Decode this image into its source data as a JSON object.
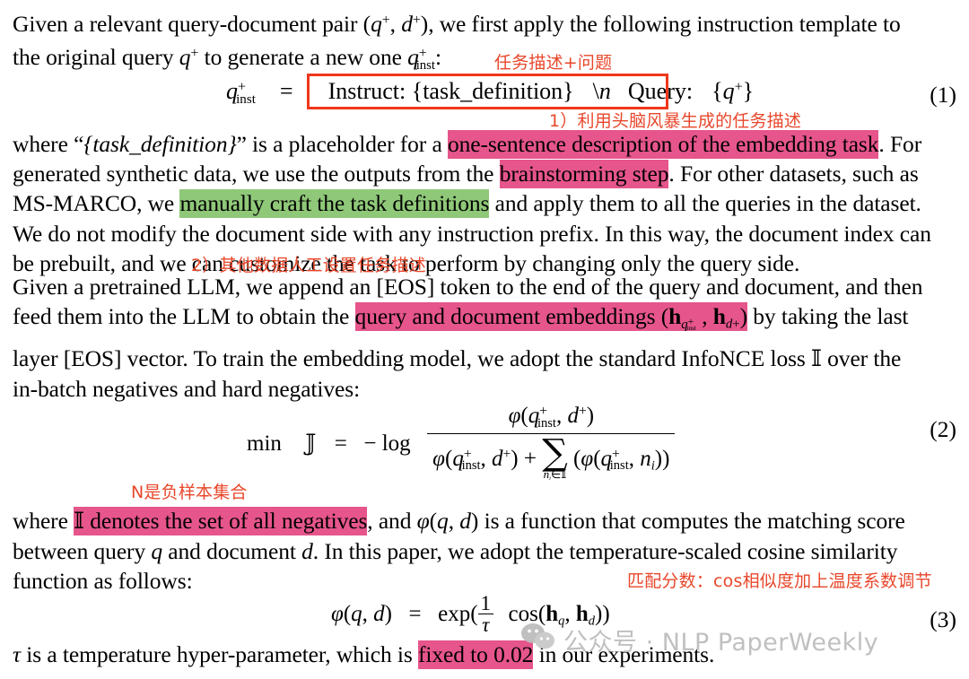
{
  "document": {
    "type": "academic-paper-excerpt-annotated",
    "paragraphs": {
      "p1": {
        "lines": [
          "Given a relevant query-document pair (q+, d+), we first apply the following instruction template to",
          "the original query q+ to generate a new one q+inst:"
        ]
      },
      "p2": {
        "line1_pre": "where “{task_definition}” is a placeholder for a ",
        "line1_hl": "one-sentence description of the embedding task",
        "line1_post": ". For",
        "line2_pre": "generated synthetic data, we use the outputs from the ",
        "line2_hl": "brainstorming step",
        "line2_post": ". For other datasets, such as",
        "line3_pre": "MS-MARCO, we ",
        "line3_hl": "manually craft the task definitions",
        "line3_post": " and apply them to all the queries in the dataset.",
        "line4": "We do not modify the document side with any instruction prefix. In this way, the document index can",
        "line5": "be prebuilt, and we can customize the task to perform by changing only the query side."
      },
      "p3": {
        "line1": "Given a pretrained LLM, we append an [EOS] token to the end of the query and document, and then",
        "line2_pre": "feed them into the LLM to obtain the ",
        "line2_hl": "query and document embeddings (h",
        "line2_hl_sub": "q+inst",
        "line2_hl_mid": " , h",
        "line2_hl_sub2": "d+",
        "line2_hl_end": ")",
        "line2_post": " by taking the last",
        "line3": "layer [EOS] vector. To train the embedding model, we adopt the standard InfoNCE loss L over the",
        "line4": "in-batch negatives and hard negatives:"
      },
      "p4": {
        "line1_pre": "where ",
        "line1_hl": "N denotes the set of all negatives",
        "line1_post": ", and ϕ(q, d) is a function that computes the matching score",
        "line2": "between query q and document d. In this paper, we adopt the temperature-scaled cosine similarity",
        "line3": "function as follows:"
      },
      "p5": {
        "pre": "τ is a temperature hyper-parameter, which is ",
        "hl": "fixed to 0.02",
        "post": " in our experiments."
      }
    },
    "equations": {
      "eq1": {
        "number": "(1)",
        "lhs": "q",
        "lhs_sup": "+",
        "lhs_sub": "inst",
        "eq_sign": "=",
        "boxed": "Instruct: {task_definition} \\n Query: {q+}",
        "boxed_parts": {
          "instruct": "Instruct: {task_definition}",
          "newline": "\\n",
          "query": "Query:",
          "qplus": "{q+}"
        }
      },
      "eq2": {
        "number": "(2)",
        "min": "min",
        "loss": "L",
        "eq_sign": "=",
        "neg_log": "− log",
        "numerator": "ϕ(q+inst, d+)",
        "denominator_left": "ϕ(q+inst, d+) +",
        "sum_sign": "∑",
        "sum_subscript": "nᵢ∈N",
        "denominator_right": "(ϕ(q+inst, nᵢ))"
      },
      "eq3": {
        "number": "(3)",
        "lhs": "ϕ(q, d)",
        "eq_sign": "=",
        "exp": "exp(",
        "frac_num": "1",
        "frac_den": "τ",
        "cos": "cos(h",
        "hq_sub": "q",
        "comma": ", h",
        "hd_sub": "d",
        "close": "))"
      }
    },
    "annotations": [
      {
        "id": "annot-1",
        "text": "任务描述+问题",
        "color": "#e8472b"
      },
      {
        "id": "annot-2",
        "text": "1）利用头脑风暴生成的任务描述",
        "color": "#e8472b"
      },
      {
        "id": "annot-3",
        "text": "2）其他数据人工设置任务描述",
        "color": "#e8472b"
      },
      {
        "id": "annot-4",
        "text": "N是负样本集合",
        "color": "#e8472b"
      },
      {
        "id": "annot-5",
        "text": "匹配分数：cos相似度加上温度系数调节",
        "color": "#e8472b"
      }
    ],
    "watermark": {
      "text": "公众号 · NLP PaperWeekly",
      "icon": "wechat-icon",
      "color": "#bdbdbd"
    },
    "colors": {
      "highlight_pink": "#e6558b",
      "highlight_green": "#8fc878",
      "annotation_red": "#e8472b",
      "box_red": "#f0361b",
      "text": "#000000",
      "background": "#ffffff"
    }
  }
}
